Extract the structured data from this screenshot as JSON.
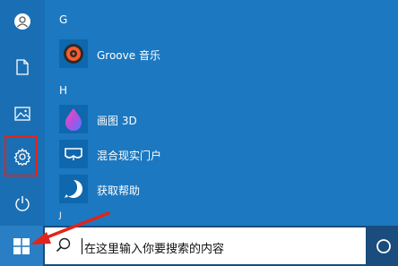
{
  "start_menu": {
    "sections": [
      {
        "letter": "G",
        "apps": [
          {
            "label": "Groove 音乐",
            "icon": "groove-music-icon"
          }
        ]
      },
      {
        "letter": "H",
        "apps": [
          {
            "label": "画图 3D",
            "icon": "paint-3d-icon"
          },
          {
            "label": "混合现实门户",
            "icon": "mixed-reality-icon"
          },
          {
            "label": "获取帮助",
            "icon": "get-help-icon"
          }
        ]
      },
      {
        "letter": "J",
        "apps": []
      }
    ]
  },
  "rail": {
    "items": [
      {
        "icon": "user-icon"
      },
      {
        "icon": "document-icon"
      },
      {
        "icon": "pictures-icon"
      },
      {
        "icon": "settings-gear-icon",
        "highlighted": true
      },
      {
        "icon": "power-icon"
      }
    ]
  },
  "taskbar": {
    "search_placeholder": "在这里输入你要搜索的内容"
  },
  "annotation": {
    "highlight_color": "#e0241b",
    "arrow_color": "#e0241b"
  }
}
